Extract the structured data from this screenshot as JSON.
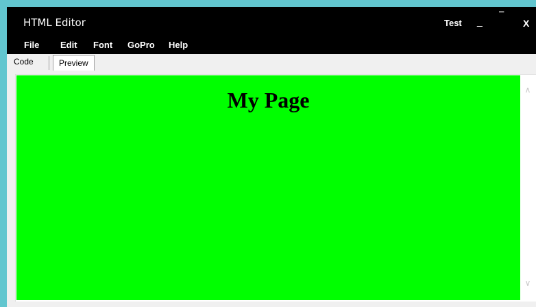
{
  "window": {
    "title": "HTML Editor",
    "user_label": "Test",
    "minimize_glyph": "_",
    "maximize_glyph": "‾",
    "close_glyph": "X"
  },
  "menu": {
    "items": [
      {
        "label": "File"
      },
      {
        "label": "Edit"
      },
      {
        "label": "Font"
      },
      {
        "label": "GoPro"
      },
      {
        "label": "Help"
      }
    ]
  },
  "tabs": {
    "items": [
      {
        "label": "Code",
        "active": false
      },
      {
        "label": "Preview",
        "active": true
      }
    ]
  },
  "preview": {
    "background": "#00ff00",
    "heading": "My Page"
  },
  "scrollbar": {
    "up_arrow": "∧",
    "down_arrow": "∨"
  },
  "colors": {
    "titlebar": "#000000",
    "window_border": "#62c6cf",
    "preview_background": "#00ff00"
  }
}
